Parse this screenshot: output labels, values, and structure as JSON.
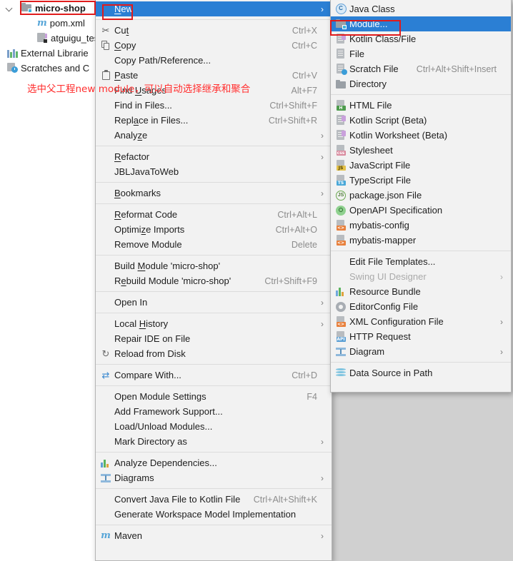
{
  "tree": {
    "items": [
      {
        "label": "micro-shop",
        "icon": "module-icon",
        "indent": 30,
        "bold": true,
        "twisty": true,
        "highlighted": true
      },
      {
        "label": "pom.xml",
        "icon": "maven-file-icon",
        "indent": 52,
        "bold": false,
        "twisty": false,
        "highlighted": false
      },
      {
        "label": "atguigu_test.i",
        "icon": "iml-file-icon",
        "indent": 52,
        "bold": false,
        "twisty": false,
        "highlighted": false
      },
      {
        "label": "External Librarie",
        "icon": "external-libraries-icon",
        "indent": 10,
        "bold": false,
        "twisty": false,
        "highlighted": false
      },
      {
        "label": "Scratches and C",
        "icon": "scratches-icon",
        "indent": 10,
        "bold": false,
        "twisty": false,
        "highlighted": false
      }
    ]
  },
  "annotation": {
    "text": "选中父工程new module，可以自动选择继承和聚合",
    "color": "#ff2d2d",
    "boxes": [
      "micro-shop-tree-node",
      "new-menu-item",
      "module-submenu-item"
    ]
  },
  "context_menu": {
    "name": "project-view-context-menu",
    "items": [
      {
        "label": "New",
        "accel": "",
        "icon": "",
        "submenu": true,
        "selected": true,
        "mnemonic": "N"
      },
      {
        "type": "separator"
      },
      {
        "label": "Cut",
        "accel": "Ctrl+X",
        "icon": "cut-icon",
        "submenu": false,
        "mnemonic": "t"
      },
      {
        "label": "Copy",
        "accel": "Ctrl+C",
        "icon": "copy-icon",
        "submenu": false,
        "mnemonic": "C"
      },
      {
        "label": "Copy Path/Reference...",
        "accel": "",
        "icon": "",
        "submenu": false
      },
      {
        "label": "Paste",
        "accel": "Ctrl+V",
        "icon": "paste-icon",
        "submenu": false,
        "mnemonic": "P"
      },
      {
        "label": "Find Usages",
        "accel": "Alt+F7",
        "icon": "",
        "submenu": false,
        "mnemonic": "U"
      },
      {
        "label": "Find in Files...",
        "accel": "Ctrl+Shift+F",
        "icon": "",
        "submenu": false
      },
      {
        "label": "Replace in Files...",
        "accel": "Ctrl+Shift+R",
        "icon": "",
        "submenu": false,
        "mnemonic": "a"
      },
      {
        "label": "Analyze",
        "accel": "",
        "icon": "",
        "submenu": true,
        "mnemonic": "z"
      },
      {
        "type": "separator"
      },
      {
        "label": "Refactor",
        "accel": "",
        "icon": "",
        "submenu": true,
        "mnemonic": "R"
      },
      {
        "label": "JBLJavaToWeb",
        "accel": "",
        "icon": "",
        "submenu": false
      },
      {
        "type": "separator"
      },
      {
        "label": "Bookmarks",
        "accel": "",
        "icon": "",
        "submenu": true,
        "mnemonic": "B"
      },
      {
        "type": "separator"
      },
      {
        "label": "Reformat Code",
        "accel": "Ctrl+Alt+L",
        "icon": "",
        "submenu": false,
        "mnemonic": "R"
      },
      {
        "label": "Optimize Imports",
        "accel": "Ctrl+Alt+O",
        "icon": "",
        "submenu": false,
        "mnemonic": "z"
      },
      {
        "label": "Remove Module",
        "accel": "Delete",
        "icon": "",
        "submenu": false
      },
      {
        "type": "separator"
      },
      {
        "label": "Build Module 'micro-shop'",
        "accel": "",
        "icon": "",
        "submenu": false,
        "mnemonic": "M"
      },
      {
        "label": "Rebuild Module 'micro-shop'",
        "accel": "Ctrl+Shift+F9",
        "icon": "",
        "submenu": false,
        "mnemonic": "e"
      },
      {
        "type": "separator"
      },
      {
        "label": "Open In",
        "accel": "",
        "icon": "",
        "submenu": true
      },
      {
        "type": "separator"
      },
      {
        "label": "Local History",
        "accel": "",
        "icon": "",
        "submenu": true,
        "mnemonic": "H"
      },
      {
        "label": "Repair IDE on File",
        "accel": "",
        "icon": "",
        "submenu": false
      },
      {
        "label": "Reload from Disk",
        "accel": "",
        "icon": "reload-icon",
        "submenu": false
      },
      {
        "type": "separator"
      },
      {
        "label": "Compare With...",
        "accel": "Ctrl+D",
        "icon": "compare-icon",
        "submenu": false
      },
      {
        "type": "separator"
      },
      {
        "label": "Open Module Settings",
        "accel": "F4",
        "icon": "",
        "submenu": false
      },
      {
        "label": "Add Framework Support...",
        "accel": "",
        "icon": "",
        "submenu": false
      },
      {
        "label": "Load/Unload Modules...",
        "accel": "",
        "icon": "",
        "submenu": false
      },
      {
        "label": "Mark Directory as",
        "accel": "",
        "icon": "",
        "submenu": true
      },
      {
        "type": "separator"
      },
      {
        "label": "Analyze Dependencies...",
        "accel": "",
        "icon": "analyze-dependencies-icon",
        "submenu": false
      },
      {
        "label": "Diagrams",
        "accel": "",
        "icon": "diagrams-icon",
        "submenu": true
      },
      {
        "type": "separator"
      },
      {
        "label": "Convert Java File to Kotlin File",
        "accel": "Ctrl+Alt+Shift+K",
        "icon": "",
        "submenu": false
      },
      {
        "label": "Generate Workspace Model Implementation",
        "accel": "",
        "icon": "",
        "submenu": false
      },
      {
        "type": "separator"
      },
      {
        "label": "Maven",
        "accel": "",
        "icon": "maven-icon",
        "submenu": true
      }
    ]
  },
  "new_submenu": {
    "name": "new-submenu",
    "items": [
      {
        "label": "Java Class",
        "accel": "",
        "icon": "java-class-icon",
        "submenu": false
      },
      {
        "label": "Module...",
        "accel": "",
        "icon": "module-icon",
        "submenu": false,
        "selected": true
      },
      {
        "label": "Kotlin Class/File",
        "accel": "",
        "icon": "kotlin-file-icon",
        "submenu": false
      },
      {
        "label": "File",
        "accel": "",
        "icon": "file-icon",
        "submenu": false
      },
      {
        "label": "Scratch File",
        "accel": "Ctrl+Alt+Shift+Insert",
        "icon": "scratch-file-icon",
        "submenu": false
      },
      {
        "label": "Directory",
        "accel": "",
        "icon": "directory-icon",
        "submenu": false
      },
      {
        "type": "separator"
      },
      {
        "label": "HTML File",
        "accel": "",
        "icon": "html-file-icon",
        "submenu": false
      },
      {
        "label": "Kotlin Script (Beta)",
        "accel": "",
        "icon": "kotlin-file-icon",
        "submenu": false
      },
      {
        "label": "Kotlin Worksheet (Beta)",
        "accel": "",
        "icon": "kotlin-file-icon",
        "submenu": false
      },
      {
        "label": "Stylesheet",
        "accel": "",
        "icon": "css-file-icon",
        "submenu": false
      },
      {
        "label": "JavaScript File",
        "accel": "",
        "icon": "js-file-icon",
        "submenu": false
      },
      {
        "label": "TypeScript File",
        "accel": "",
        "icon": "ts-file-icon",
        "submenu": false
      },
      {
        "label": "package.json File",
        "accel": "",
        "icon": "nodejs-icon",
        "submenu": false
      },
      {
        "label": "OpenAPI Specification",
        "accel": "",
        "icon": "openapi-icon",
        "submenu": false
      },
      {
        "label": "mybatis-config",
        "accel": "",
        "icon": "xml-file-icon",
        "submenu": false
      },
      {
        "label": "mybatis-mapper",
        "accel": "",
        "icon": "xml-file-icon",
        "submenu": false
      },
      {
        "type": "separator"
      },
      {
        "label": "Edit File Templates...",
        "accel": "",
        "icon": "",
        "submenu": false
      },
      {
        "label": "Swing UI Designer",
        "accel": "",
        "icon": "",
        "submenu": true,
        "disabled": true
      },
      {
        "label": "Resource Bundle",
        "accel": "",
        "icon": "resource-bundle-icon",
        "submenu": false
      },
      {
        "label": "EditorConfig File",
        "accel": "",
        "icon": "gear-icon",
        "submenu": false
      },
      {
        "label": "XML Configuration File",
        "accel": "",
        "icon": "xml-file-icon",
        "submenu": true
      },
      {
        "label": "HTTP Request",
        "accel": "",
        "icon": "http-request-icon",
        "submenu": false
      },
      {
        "label": "Diagram",
        "accel": "",
        "icon": "diagram-icon",
        "submenu": true
      },
      {
        "type": "separator"
      },
      {
        "label": "Data Source in Path",
        "accel": "",
        "icon": "database-icon",
        "submenu": false
      }
    ]
  },
  "colors": {
    "menu_background": "#f2f2f2",
    "selection_blue": "#2b7fd4",
    "accelerator_gray": "#8c8c8c",
    "annotation_red": "#ff2d2d",
    "desktop_gray": "#d0d0d0"
  }
}
